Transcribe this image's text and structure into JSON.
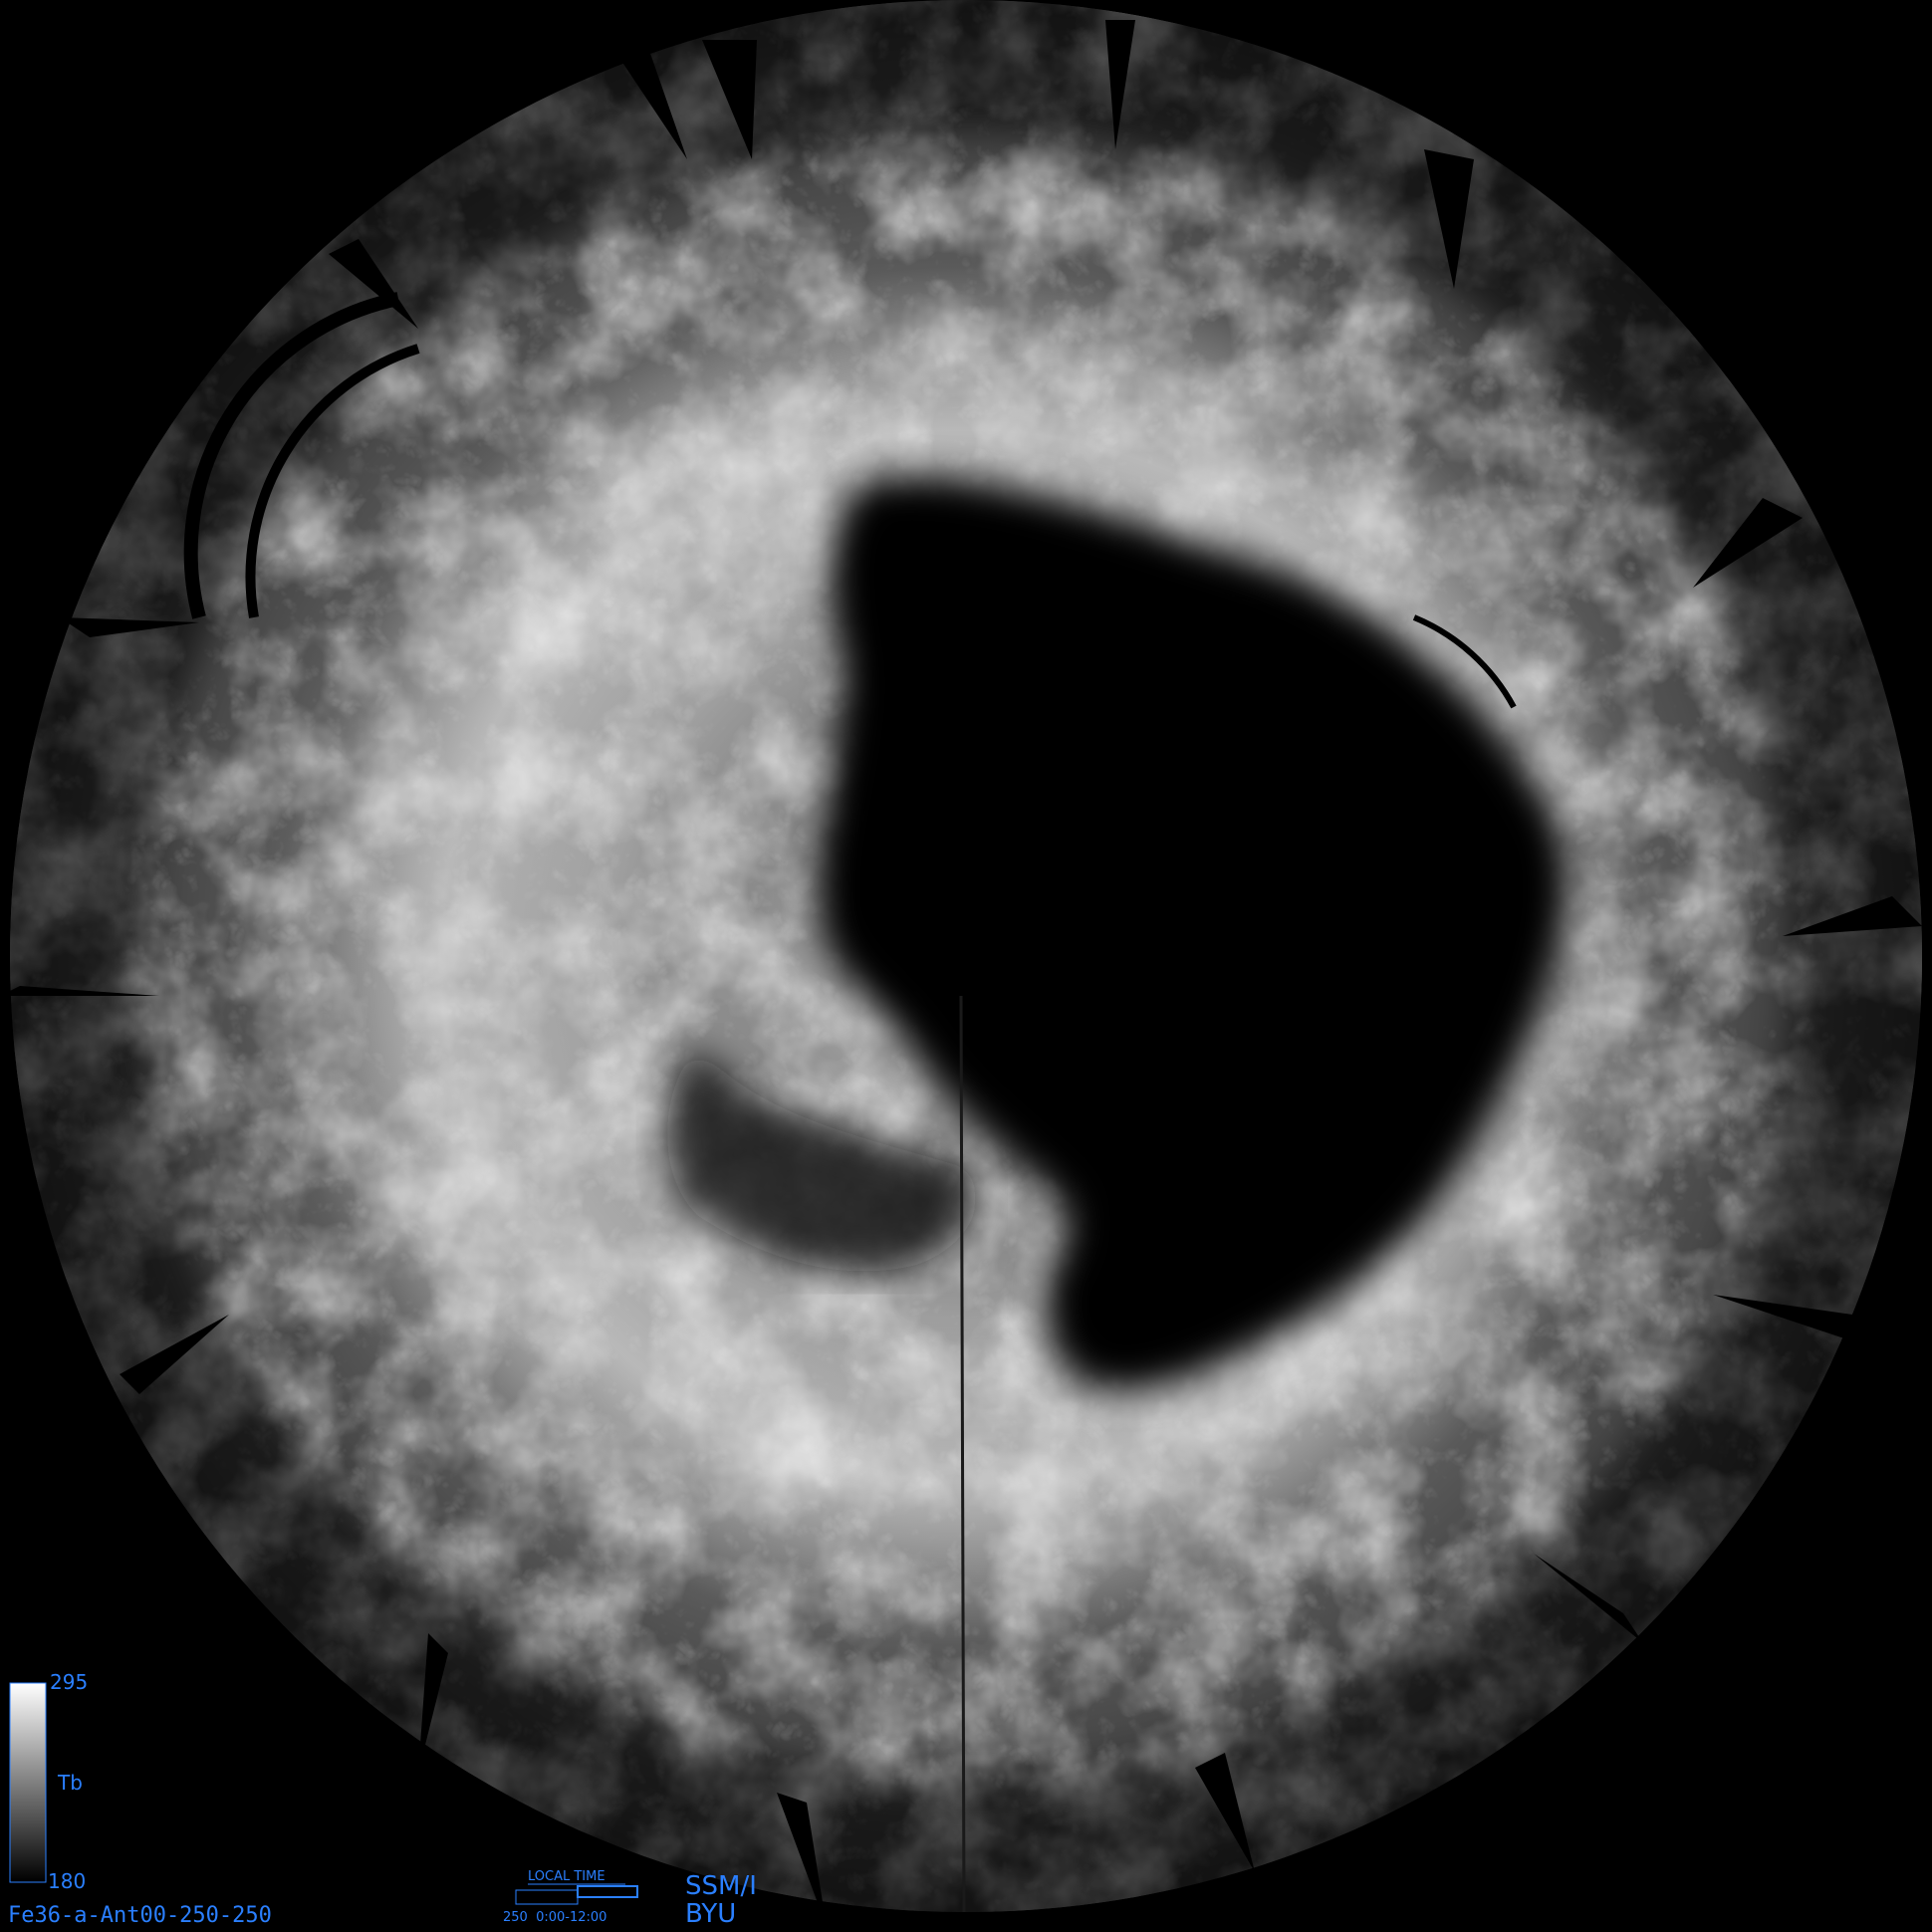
{
  "image": {
    "subject": "polar-stereographic satellite brightness-temperature mosaic",
    "background_color": "#000000",
    "accent_color": "#2a7fff"
  },
  "colorbar": {
    "max_label": "295",
    "mid_label": "Tb",
    "min_label": "180",
    "max_value": 295,
    "min_value": 180,
    "gradient_top": "#ffffff",
    "gradient_bottom": "#000000"
  },
  "footer": {
    "product_id": "Fe36-a-Ant00-250-250",
    "local_time_title": "LOCAL TIME",
    "local_time_range": "250  0:00-12:00",
    "sensor": "SSM/I",
    "institution": "BYU"
  }
}
